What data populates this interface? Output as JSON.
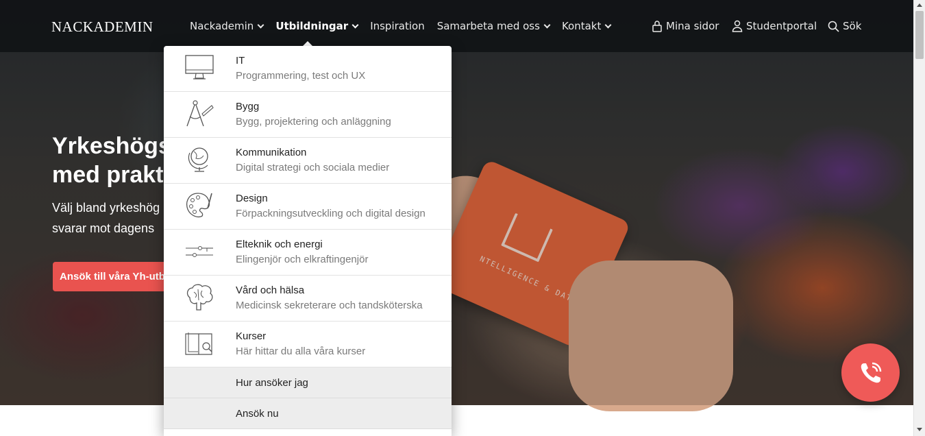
{
  "header": {
    "logo": "NACKADEMIN",
    "nav": [
      {
        "label": "Nackademin",
        "has_dropdown": true,
        "active": false
      },
      {
        "label": "Utbildningar",
        "has_dropdown": true,
        "active": true
      },
      {
        "label": "Inspiration",
        "has_dropdown": false,
        "active": false
      },
      {
        "label": "Samarbeta med oss",
        "has_dropdown": true,
        "active": false
      },
      {
        "label": "Kontakt",
        "has_dropdown": true,
        "active": false
      }
    ],
    "utility": {
      "mina_sidor": "Mina sidor",
      "studentportal": "Studentportal",
      "search": "Sök"
    }
  },
  "hero": {
    "title_line1": "Yrkeshögs",
    "title_line2": "med prakt",
    "sub_line1": "Välj bland yrkeshög",
    "sub_line2": "svarar mot dagens",
    "cta": "Ansök till våra Yh-utb",
    "card_text": "NTELLIGENCE & DATA"
  },
  "dropdown": {
    "items": [
      {
        "icon": "monitor-icon",
        "title": "IT",
        "desc": "Programmering, test och UX"
      },
      {
        "icon": "compass-ruler-icon",
        "title": "Bygg",
        "desc": "Bygg, projektering och anläggning"
      },
      {
        "icon": "globe-icon",
        "title": "Kommunikation",
        "desc": "Digital strategi och sociala medier"
      },
      {
        "icon": "palette-icon",
        "title": "Design",
        "desc": "Förpackningsutveckling och digital design"
      },
      {
        "icon": "circuit-icon",
        "title": "Elteknik och energi",
        "desc": "Elingenjör och elkraftingenjör"
      },
      {
        "icon": "brain-icon",
        "title": "Vård och hälsa",
        "desc": "Medicinsk sekreterare och tandsköterska"
      },
      {
        "icon": "book-search-icon",
        "title": "Kurser",
        "desc": "Här hittar du alla våra kurser"
      }
    ],
    "links": [
      "Hur ansöker jag",
      "Ansök nu"
    ]
  },
  "colors": {
    "accent": "#e9534f",
    "phone_button": "#ef5a58",
    "header_bg": "#101214"
  }
}
